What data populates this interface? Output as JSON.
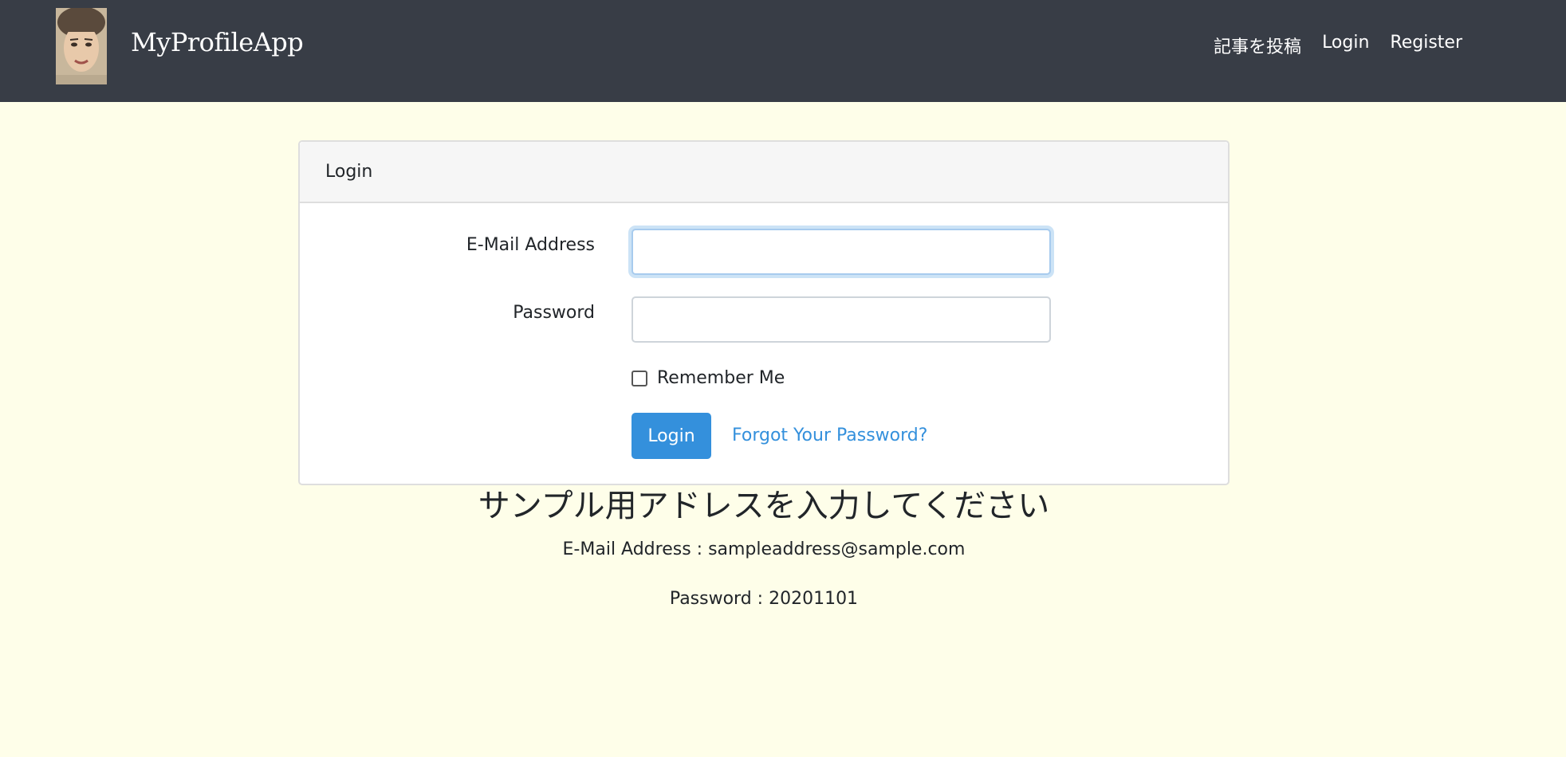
{
  "navbar": {
    "brand": "MyProfileApp",
    "links": [
      "記事を投稿",
      "Login",
      "Register"
    ]
  },
  "login_card": {
    "header": "Login",
    "email_label": "E-Mail Address",
    "email_value": "",
    "password_label": "Password",
    "password_value": "",
    "remember_label": "Remember Me",
    "remember_checked": false,
    "login_button": "Login",
    "forgot_link": "Forgot Your Password?"
  },
  "sample": {
    "title": "サンプル用アドレスを入力してください",
    "email_line": "E-Mail Address : sampleaddress@sample.com",
    "password_line": "Password : 20201101"
  },
  "colors": {
    "navbar_bg": "#383d46",
    "page_bg": "#fefee9",
    "accent": "#3490dc"
  }
}
